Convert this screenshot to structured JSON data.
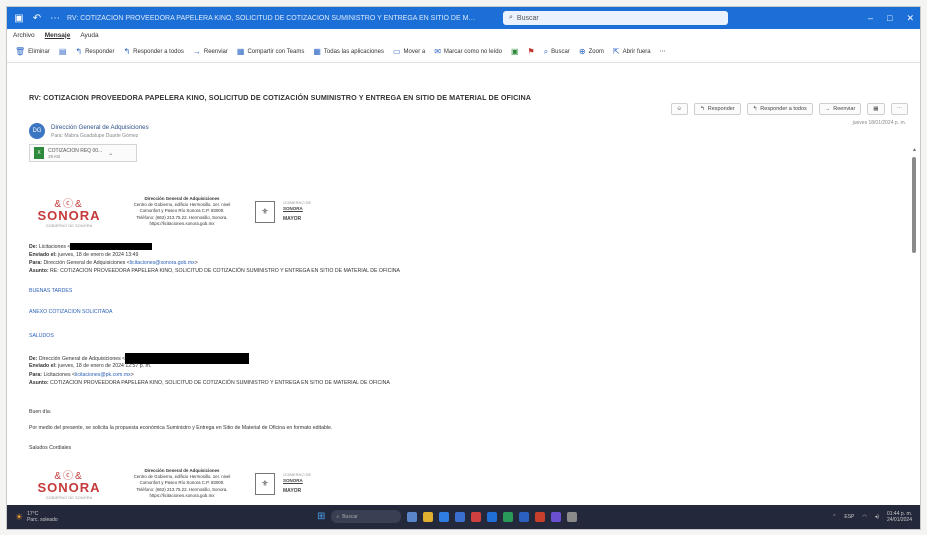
{
  "window": {
    "title": "RV: COTIZACION PROVEEDORA PAPELERA KINO, SOLICITUD DE COTIZACIÓN SUMINISTRO Y ENTREGA EN SITIO DE MATERIAL DE OFICINA",
    "search_placeholder": "Buscar"
  },
  "menu": [
    "Archivo",
    "Mensaje",
    "Ayuda"
  ],
  "toolbar": [
    "Eliminar",
    "Responder",
    "Responder a todos",
    "Reenviar",
    "Compartir con Teams",
    "Todas las aplicaciones",
    "Mover a",
    "Marcar como no leído",
    "Buscar",
    "Zoom",
    "Abrir fuera"
  ],
  "message": {
    "subject": "RV: COTIZACION PROVEEDORA PAPELERA KINO, SOLICITUD DE COTIZACIÓN SUMINISTRO Y ENTREGA EN SITIO DE MATERIAL DE OFICINA",
    "avatar_initials": "DG",
    "sender_name": "Dirección General de Adquisiciones",
    "sender_to": "Para: Mabra Guadalupe Duarte Gómez",
    "received": "jueves 18/01/2024 p. m.",
    "actions": [
      "Responder",
      "Responder a todos",
      "Reenviar"
    ],
    "attachment_name": "COTIZACION REQ 00...",
    "attachment_size": "39 KB"
  },
  "letterhead": {
    "brand": "SONORA",
    "tagline": "GOBIERNO DE SONORA",
    "title": "Dirección General de Adquisiciones",
    "line1": "Centro de Gobierno, edificio Hermosillo, 1er. nivel",
    "line2": "Comonfort y Paseo Río Sonora C.P. 83000.",
    "line3": "Teléfono: (662) 213.75.22. Hermosillo, Sonora.",
    "url": "https://licitaciones.sonora.gob.mx",
    "gob1": "GOBIERNO DE",
    "gob2": "SONORA",
    "gob3": "MAYOR"
  },
  "thread": {
    "de_label": "De:",
    "de_value": "Licitaciones <",
    "enviado_label": "Enviado el:",
    "enviado_value": "jueves, 18 de enero de 2024 13:49",
    "para_label": "Para:",
    "para_value": "Dirección General de Adquisiciones <",
    "para_email": "licitaciones@sonora.gob.mx",
    "asunto_label": "Asunto:",
    "asunto_value": "RE: COTIZACION PROVEEDORA PAPELERA KINO, SOLICITUD DE COTIZACIÓN SUMINISTRO Y ENTREGA EN SITIO DE MATERIAL DE OFICINA",
    "greeting": "BUENAS TARDES",
    "line": "ANEXO COTIZACION SOLICITADA",
    "closing": "SALUDOS"
  },
  "thread2": {
    "de_value": "Dirección General de Adquisiciones <",
    "enviado_value": "jueves, 18 de enero de 2024 12:57 p. m.",
    "para_value": "Licitaciones <",
    "para_email": "licitaciones@pk.com.mx",
    "asunto_value": "COTIZACION PROVEEDORA PAPELERA KINO, SOLICITUD DE COTIZACIÓN SUMINISTRO Y ENTREGA EN SITIO DE MATERIAL DE OFICINA",
    "greeting": "Buen día:",
    "body": "Por medio del presente, se solicita la propuesta económica Suministro y Entrega en Sitio de Material de Oficina en formato editable.",
    "closing": "Saludos Cordiales"
  },
  "taskbar": {
    "weather_temp": "17°C",
    "weather_desc": "Parc. soleado",
    "search": "Buscar",
    "lang": "ESP",
    "time": "01:44 p. m.",
    "date": "24/01/2024"
  },
  "colors": {
    "titlebar": "#1c6fd6",
    "sonora_red": "#c43a3a",
    "link": "#2a5fb5",
    "taskbar": "#23283a"
  }
}
